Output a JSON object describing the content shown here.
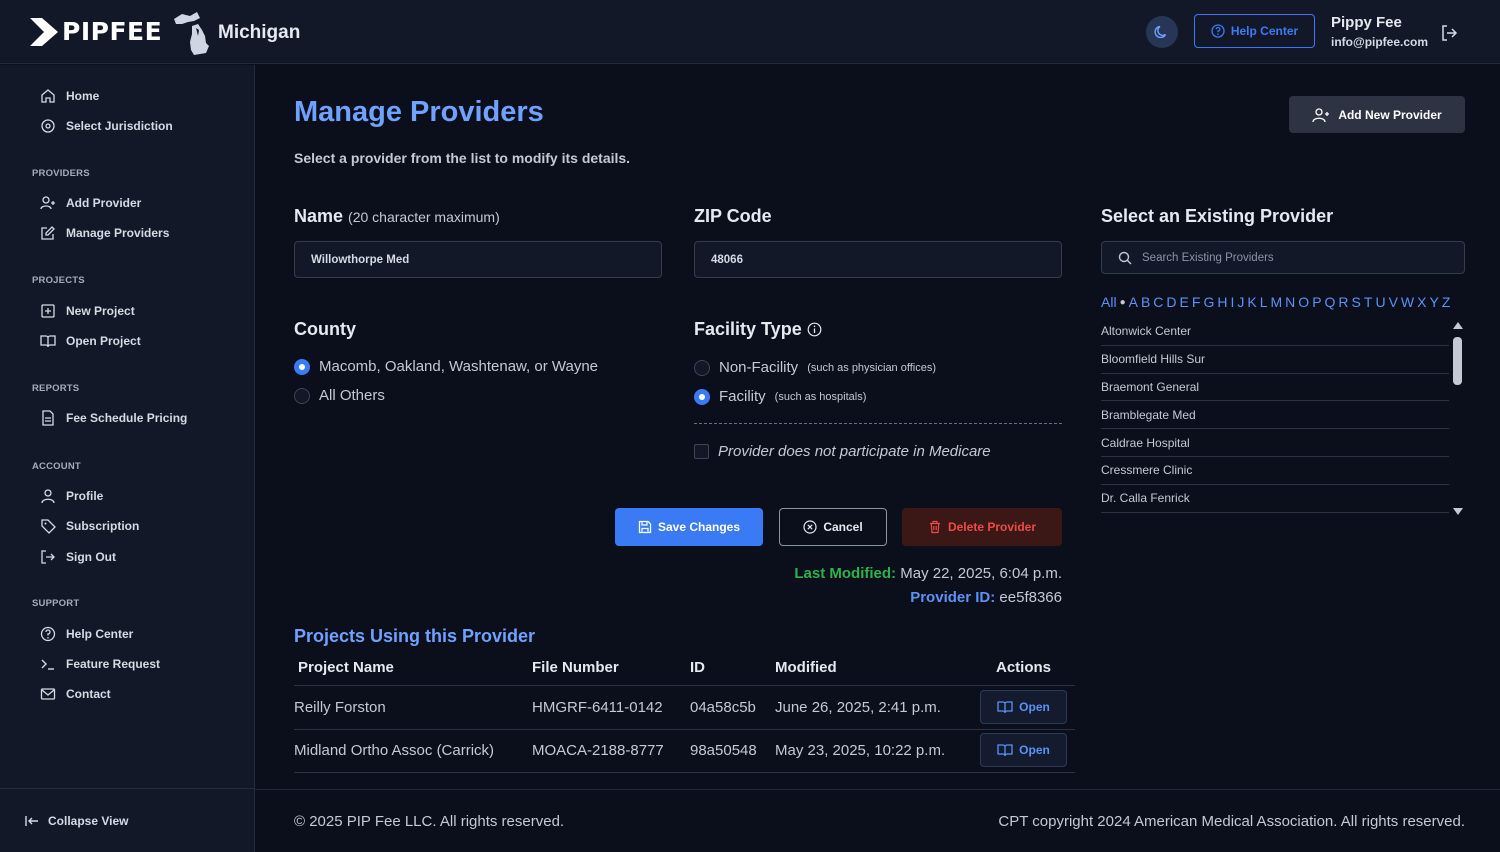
{
  "header": {
    "brand": "PIPFEE",
    "state": "Michigan",
    "help_label": "Help Center",
    "user_name": "Pippy Fee",
    "user_email": "info@pipfee.com"
  },
  "sidebar": {
    "top": [
      {
        "label": "Home",
        "icon": "home-icon"
      },
      {
        "label": "Select Jurisdiction",
        "icon": "map-pin-icon"
      }
    ],
    "sections": [
      {
        "title": "PROVIDERS",
        "items": [
          {
            "label": "Add Provider",
            "icon": "user-plus-icon"
          },
          {
            "label": "Manage Providers",
            "icon": "edit-icon"
          }
        ]
      },
      {
        "title": "PROJECTS",
        "items": [
          {
            "label": "New Project",
            "icon": "plus-square-icon"
          },
          {
            "label": "Open Project",
            "icon": "book-open-icon"
          }
        ]
      },
      {
        "title": "REPORTS",
        "items": [
          {
            "label": "Fee Schedule Pricing",
            "icon": "document-icon"
          }
        ]
      },
      {
        "title": "ACCOUNT",
        "items": [
          {
            "label": "Profile",
            "icon": "user-icon"
          },
          {
            "label": "Subscription",
            "icon": "tag-icon"
          },
          {
            "label": "Sign Out",
            "icon": "sign-out-icon"
          }
        ]
      },
      {
        "title": "SUPPORT",
        "items": [
          {
            "label": "Help Center",
            "icon": "help-circle-icon"
          },
          {
            "label": "Feature Request",
            "icon": "terminal-icon"
          },
          {
            "label": "Contact",
            "icon": "mail-icon"
          }
        ]
      }
    ],
    "collapse_label": "Collapse View"
  },
  "main": {
    "title": "Manage Providers",
    "subtitle": "Select a provider from the list to modify its details.",
    "add_button": "Add New Provider",
    "name_label": "Name",
    "name_hint": "(20 character maximum)",
    "name_value": "Willowthorpe Med",
    "zip_label": "ZIP Code",
    "zip_value": "48066",
    "county_label": "County",
    "county_options": [
      {
        "label": "Macomb, Oakland, Washtenaw, or Wayne",
        "checked": true
      },
      {
        "label": "All Others",
        "checked": false
      }
    ],
    "facility_label": "Facility Type",
    "facility_options": [
      {
        "label": "Non-Facility",
        "hint": "(such as physician offices)",
        "checked": false
      },
      {
        "label": "Facility",
        "hint": "(such as hospitals)",
        "checked": true
      }
    ],
    "medicare_label": "Provider does not participate in Medicare",
    "medicare_checked": false,
    "save_label": "Save Changes",
    "cancel_label": "Cancel",
    "delete_label": "Delete Provider",
    "last_modified_label": "Last Modified:",
    "last_modified_value": "May 22, 2025, 6:04 p.m.",
    "provider_id_label": "Provider ID:",
    "provider_id_value": "ee5f8366"
  },
  "projects": {
    "title": "Projects Using this Provider",
    "columns": [
      "Project Name",
      "File Number",
      "ID",
      "Modified",
      "Actions"
    ],
    "rows": [
      {
        "name": "Reilly Forston",
        "file": "HMGRF-6411-0142",
        "id": "04a58c5b",
        "modified": "June 26, 2025, 2:41 p.m.",
        "action": "Open"
      },
      {
        "name": "Midland Ortho Assoc (Carrick)",
        "file": "MOACA-2188-8777",
        "id": "98a50548",
        "modified": "May 23, 2025, 10:22 p.m.",
        "action": "Open"
      }
    ]
  },
  "existing": {
    "title": "Select an Existing Provider",
    "search_placeholder": "Search Existing Providers",
    "alpha_all": "All",
    "letters": [
      "A",
      "B",
      "C",
      "D",
      "E",
      "F",
      "G",
      "H",
      "I",
      "J",
      "K",
      "L",
      "M",
      "N",
      "O",
      "P",
      "Q",
      "R",
      "S",
      "T",
      "U",
      "V",
      "W",
      "X",
      "Y",
      "Z"
    ],
    "providers": [
      "Altonwick Center",
      "Bloomfield Hills Sur",
      "Braemont General",
      "Bramblegate Med",
      "Caldrae Hospital",
      "Cressmere Clinic",
      "Dr. Calla Fenrick"
    ]
  },
  "footer": {
    "left": "© 2025 PIP Fee LLC. All rights reserved.",
    "right": "CPT copyright 2024 American Medical Association. All rights reserved."
  },
  "colors": {
    "accent": "#3a7bf5",
    "title": "#6fa1ff",
    "modified": "#2bb24c",
    "danger": "#ef4a4a"
  }
}
